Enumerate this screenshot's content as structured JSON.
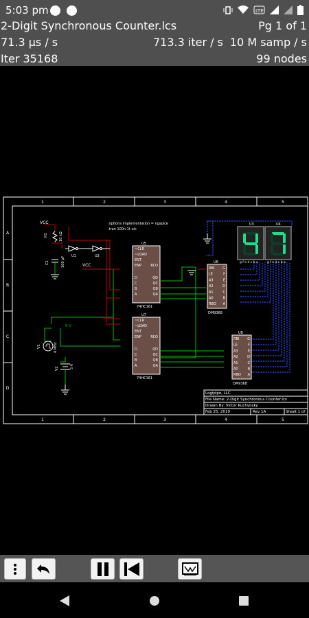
{
  "status_bar": {
    "time": "5:03 pm"
  },
  "info_bar": {
    "file_name": "2-Digit Synchronous Counter.lcs",
    "page_info": "Pg 1 of 1",
    "step_time": "71.3 µs / s",
    "iter_rate": "713.3 iter / s",
    "sample_rate": "10 M samp / s",
    "iteration": "Iter 35168",
    "nodes": "99 nodes"
  },
  "schematic": {
    "col_labels": [
      "1",
      "2",
      "3",
      "4",
      "5"
    ],
    "row_labels": [
      "A",
      "B",
      "C",
      "D"
    ],
    "vcc1": "VCC",
    "vcc2": "VCC",
    "options_line1": ".options implementation = ngspice",
    "options_line2": ".tran 100n 1t uic",
    "r1_label": "R1",
    "r1_value": "10 kΩ",
    "c1_label": "C1",
    "c1_value": "100 pF",
    "u1": "U1",
    "u2": "U2",
    "u5_ref": "U5",
    "u5_part": "74HC161",
    "u7_ref": "U7",
    "u7_part": "74HC161",
    "u6_ref": "U6",
    "u6_part": "DM9368",
    "u8_ref": "U8",
    "u8_part": "DM9368",
    "u3_ref": "U3",
    "u4_ref": "U4",
    "digit_left": "4",
    "digit_right": "7",
    "seg_pins": "g f e d c b a",
    "v1_ref": "V1",
    "v1_value": "4 MHz",
    "v2_ref": "V2",
    "v2_value": "5 V",
    "net_0v": "0 V",
    "counter_pins_left": [
      "~CLR",
      "~LOAD",
      "ENT",
      "ENP",
      "D",
      "C",
      "B",
      "A"
    ],
    "counter_pins_right": [
      "RCO",
      "QD",
      "QC",
      "QB",
      "QA"
    ],
    "decoder_pins_left": [
      "RBI",
      "LE",
      "A3",
      "A2",
      "A1",
      "A0",
      "RBO"
    ],
    "decoder_pins_right": [
      "G",
      "F",
      "E",
      "D",
      "C",
      "B",
      "A"
    ],
    "title_block": {
      "company": "Logipipe, LLC",
      "file": "File Name: 2-Digit Synchronous Counter.lcs",
      "drawn": "Drawn By: Victor Kuchynsky",
      "date": "Feb 25, 2019",
      "rev": "Rev 1A",
      "sheet": "Sheet 1 of"
    }
  },
  "toolbar": {
    "buttons": [
      "menu",
      "undo",
      "pause",
      "rewind",
      "scope"
    ]
  },
  "colors": {
    "bar_bg": "#4f4f4f",
    "wire_green": "#00c000",
    "wire_red": "#c00000",
    "wire_blue": "#2a4cff",
    "chip_fill": "#6b4f47",
    "segment_on": "#22dd88",
    "segment_off": "#0d3d2a"
  }
}
